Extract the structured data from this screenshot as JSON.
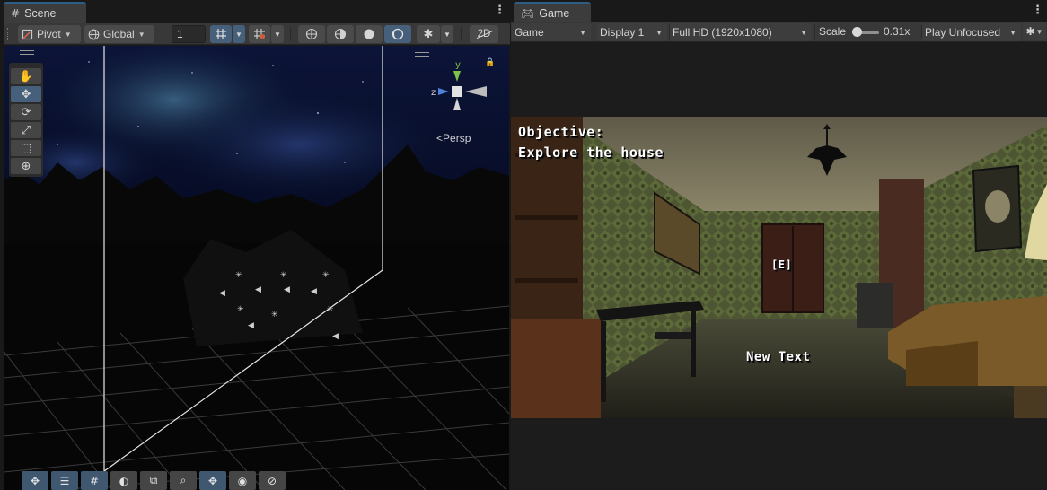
{
  "scene_panel": {
    "tab_title": "Scene",
    "tab_icon": "grid-icon",
    "toolbar": {
      "pivot_label": "Pivot",
      "global_label": "Global",
      "grid_snap_value": "1",
      "twod_label": "2D"
    },
    "tools": [
      "hand-tool",
      "move-tool",
      "rotate-tool",
      "scale-tool",
      "rect-tool",
      "transform-tool"
    ],
    "gizmo": {
      "y_label": "y",
      "z_label": "z"
    },
    "persp_label": "Persp"
  },
  "game_panel": {
    "tab_title": "Game",
    "tab_icon": "gamepad-icon",
    "toolbar": {
      "mode_label": "Game",
      "display_label": "Display 1",
      "resolution_label": "Full HD (1920x1080)",
      "scale_label": "Scale",
      "scale_value": "0.31x",
      "scale_fraction": 0.15,
      "play_mode_label": "Play Unfocused"
    },
    "hud": {
      "objective_title": "Objective:",
      "objective_text": "Explore the house",
      "interact_prompt": "[E]",
      "new_text": "New Text"
    }
  },
  "colors": {
    "accent_blue": "#46607c",
    "tab_highlight": "#2c5d87",
    "gizmo_y": "#7ec24a",
    "gizmo_x": "#c9c9c9",
    "gizmo_z": "#4f82d9"
  }
}
